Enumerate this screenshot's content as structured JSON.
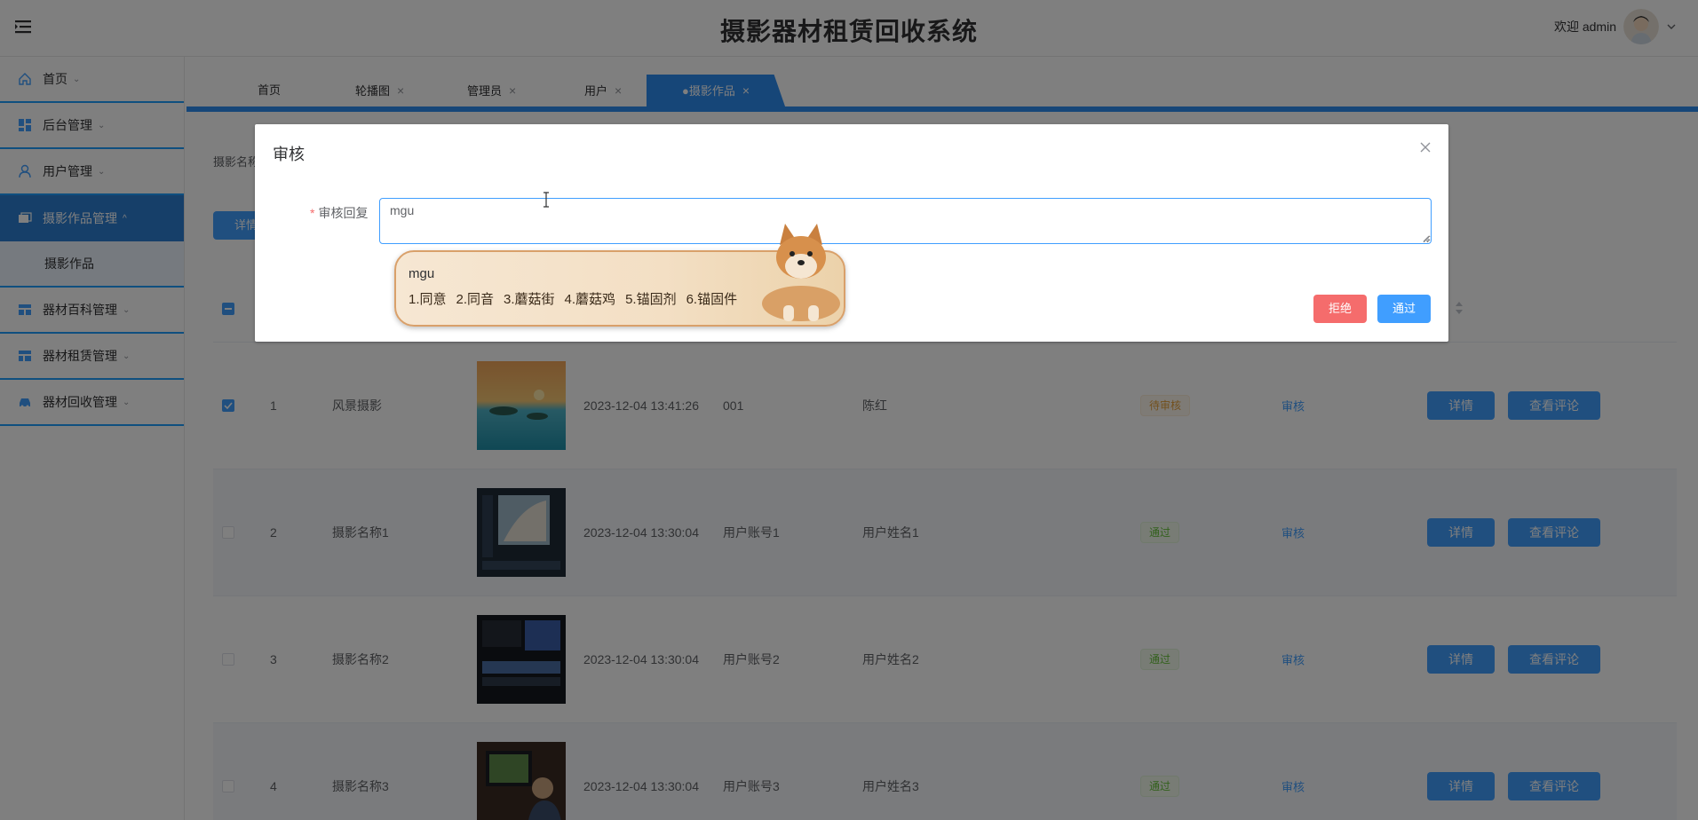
{
  "header": {
    "title": "摄影器材租赁回收系统",
    "welcome": "欢迎 admin"
  },
  "sidebar": {
    "items": [
      {
        "label": "首页",
        "icon": "home-icon"
      },
      {
        "label": "后台管理",
        "icon": "dashboard-icon"
      },
      {
        "label": "用户管理",
        "icon": "user-icon"
      },
      {
        "label": "摄影作品管理",
        "icon": "gallery-icon",
        "active": true
      },
      {
        "label": "器材百科管理",
        "icon": "layout-icon"
      },
      {
        "label": "器材租赁管理",
        "icon": "layout-icon"
      },
      {
        "label": "器材回收管理",
        "icon": "car-icon"
      }
    ],
    "submenu": {
      "label": "摄影作品"
    }
  },
  "tabs": [
    {
      "label": "首页"
    },
    {
      "label": "轮播图"
    },
    {
      "label": "管理员"
    },
    {
      "label": "用户"
    },
    {
      "label": "●摄影作品",
      "active": true
    }
  ],
  "search": {
    "label_fragment": "摄影名称"
  },
  "toolbar": {
    "detail_fragment": "详情"
  },
  "table": {
    "rows": [
      {
        "index": "1",
        "name": "风景摄影",
        "time": "2023-12-04 13:41:26",
        "account": "001",
        "username": "陈红",
        "status": "待审核",
        "status_type": "pending",
        "review": "审核",
        "detail": "详情",
        "comments": "查看评论",
        "checked": true
      },
      {
        "index": "2",
        "name": "摄影名称1",
        "time": "2023-12-04 13:30:04",
        "account": "用户账号1",
        "username": "用户姓名1",
        "status": "通过",
        "status_type": "pass",
        "review": "审核",
        "detail": "详情",
        "comments": "查看评论",
        "checked": false
      },
      {
        "index": "3",
        "name": "摄影名称2",
        "time": "2023-12-04 13:30:04",
        "account": "用户账号2",
        "username": "用户姓名2",
        "status": "通过",
        "status_type": "pass",
        "review": "审核",
        "detail": "详情",
        "comments": "查看评论",
        "checked": false
      },
      {
        "index": "4",
        "name": "摄影名称3",
        "time": "2023-12-04 13:30:04",
        "account": "用户账号3",
        "username": "用户姓名3",
        "status": "通过",
        "status_type": "pass",
        "review": "审核",
        "detail": "详情",
        "comments": "查看评论",
        "checked": false
      }
    ]
  },
  "dialog": {
    "title": "审核",
    "field_label": "审核回复",
    "required_mark": "*",
    "reply_value": "mgu",
    "reject_label": "拒绝",
    "approve_label": "通过"
  },
  "ime": {
    "composition": "mgu",
    "candidates": [
      "1.同意",
      "2.同音",
      "3.蘑菇街",
      "4.蘑菇鸡",
      "5.锚固剂",
      "6.锚固件"
    ]
  },
  "colors": {
    "primary": "#409eff",
    "active_menu": "#2d7fd3",
    "danger": "#f56c6c",
    "warning": "#e6a23c",
    "success": "#67c23a"
  }
}
